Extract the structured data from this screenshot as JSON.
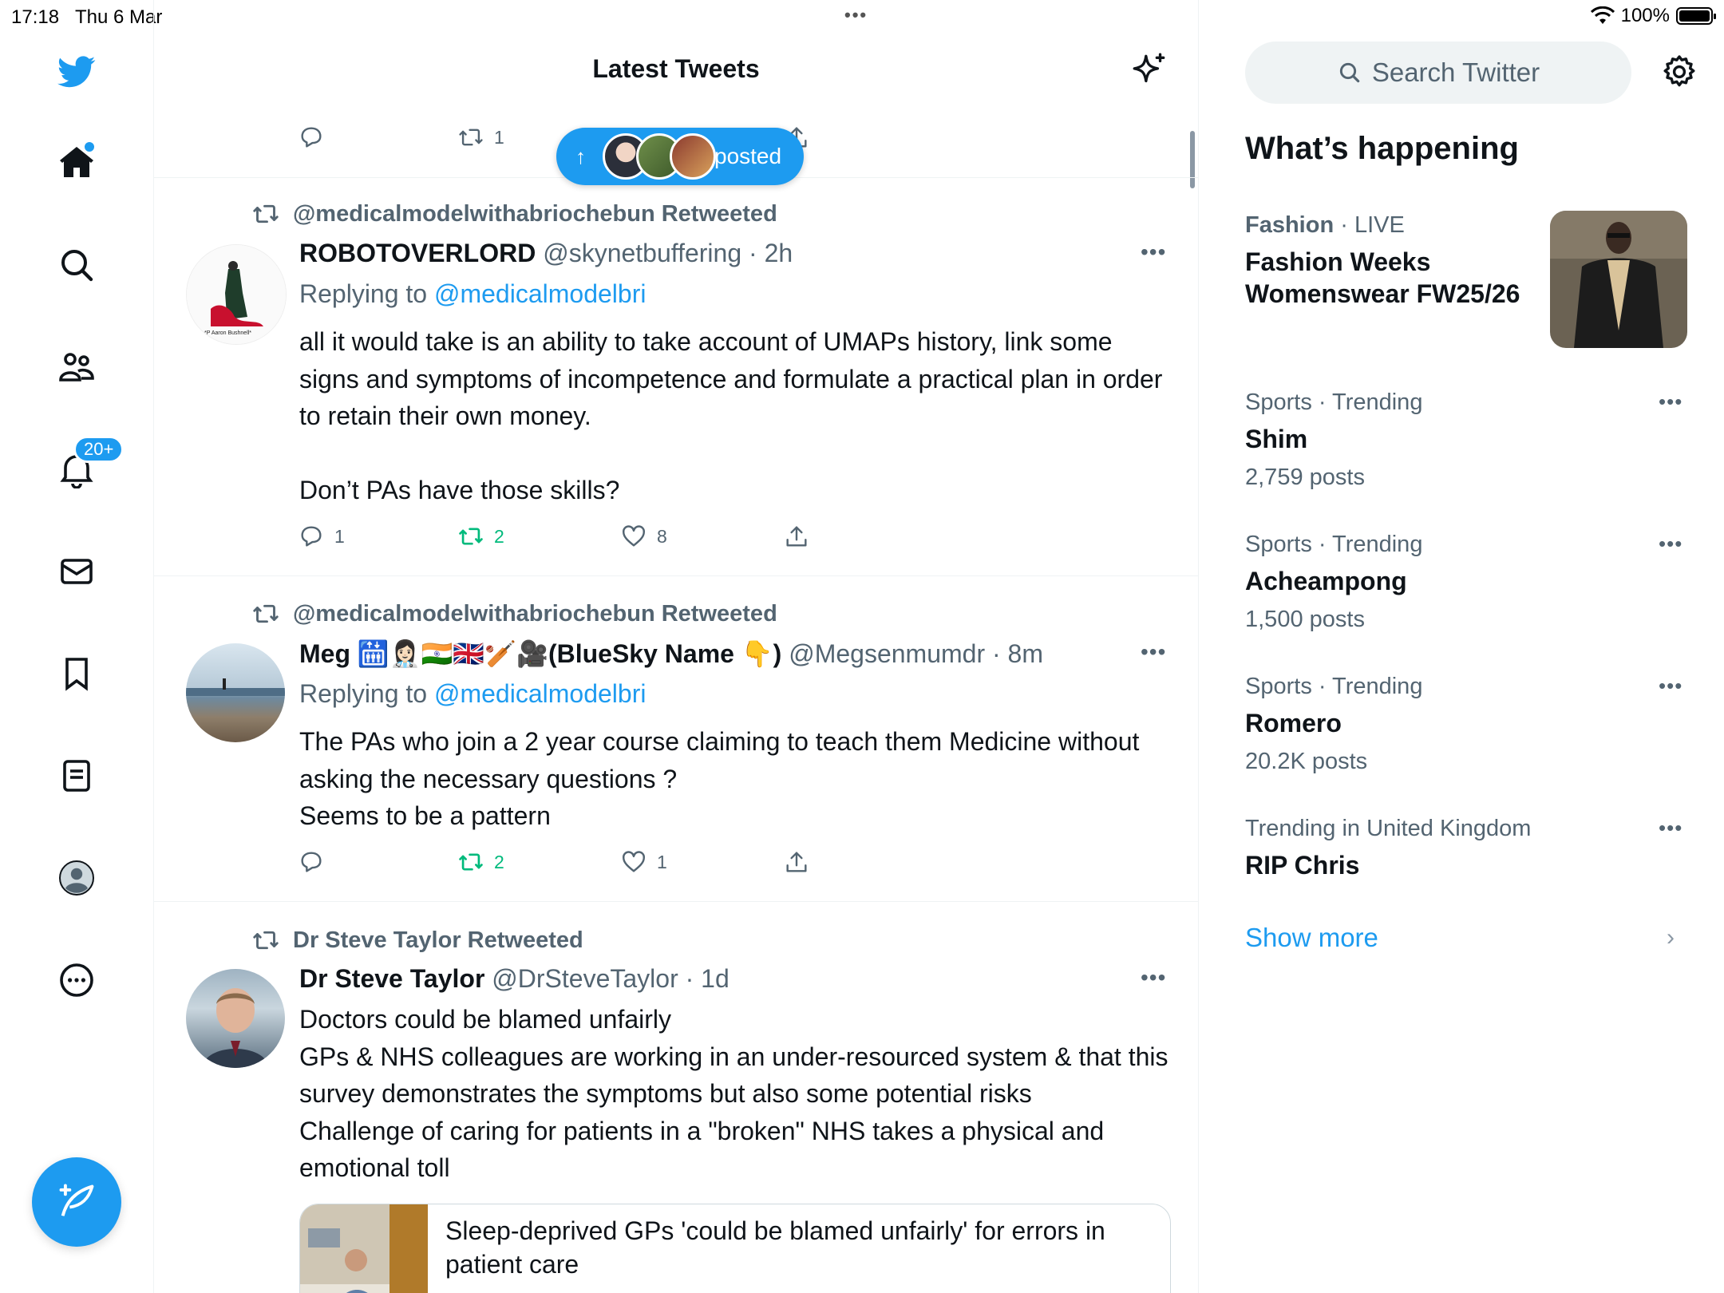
{
  "status_bar": {
    "time": "17:18",
    "date": "Thu 6 Mar",
    "battery": "100%"
  },
  "nav": {
    "notifications_badge": "20+"
  },
  "header": {
    "title": "Latest Tweets"
  },
  "new_posts_pill": {
    "label": "posted"
  },
  "top_partial_tweet": {
    "reply_count": "",
    "retweet_count": "1"
  },
  "tweets": [
    {
      "retweeted_by": "@medicalmodelwithabriochebun Retweeted",
      "name": "ROBOTOVERLORD",
      "handle": "@skynetbuffering",
      "time": "· 2h",
      "replying_prefix": "Replying to ",
      "replying_to": "@medicalmodelbri",
      "text": "all it would take is an ability to take account of UMAPs history, link some signs and symptoms of incompetence and formulate a practical plan in order to retain their own money.\n\nDon’t PAs have those skills?",
      "replies": "1",
      "retweets": "2",
      "likes": "8"
    },
    {
      "retweeted_by": "@medicalmodelwithabriochebun Retweeted",
      "name": "Meg 🛗👩🏻‍⚕️🇮🇳🇬🇧🏏🎥(BlueSky Name 👇)",
      "handle": "@Megsenmumdr",
      "time": "· 8m",
      "replying_prefix": "Replying to ",
      "replying_to": "@medicalmodelbri",
      "text": "The PAs who join a 2 year course claiming to teach them Medicine without asking the necessary questions ?\nSeems to be a pattern",
      "replies": "",
      "retweets": "2",
      "likes": "1"
    },
    {
      "retweeted_by": "Dr Steve Taylor Retweeted",
      "name": "Dr Steve Taylor",
      "handle": "@DrSteveTaylor",
      "time": "· 1d",
      "text": "Doctors could be blamed unfairly\nGPs & NHS colleagues are working in an under-resourced system & that this survey demonstrates the symptoms but also some potential risks\nChallenge of caring for patients in a \"broken\" NHS takes a physical and emotional toll",
      "card_title": "Sleep-deprived GPs 'could be blamed unfairly' for errors in patient care"
    }
  ],
  "search": {
    "placeholder": "Search Twitter"
  },
  "whats_happening": {
    "title": "What’s happening",
    "fashion": {
      "category": "Fashion",
      "live": " · LIVE",
      "title": "Fashion Weeks Womenswear FW25/26"
    },
    "trends": [
      {
        "category": "Sports · Trending",
        "title": "Shim",
        "count": "2,759 posts"
      },
      {
        "category": "Sports · Trending",
        "title": "Acheampong",
        "count": "1,500 posts"
      },
      {
        "category": "Sports · Trending",
        "title": "Romero",
        "count": "20.2K posts"
      },
      {
        "category": "Trending in United Kingdom",
        "title": "RIP Chris",
        "count": ""
      }
    ],
    "show_more": "Show more"
  },
  "colors": {
    "accent": "#1d9bf0",
    "retweet_green": "#00ba7c",
    "secondary_text": "#536471"
  },
  "icons": [
    "twitter-bird-icon",
    "home-icon",
    "search-icon",
    "communities-icon",
    "bell-icon",
    "mail-icon",
    "bookmark-icon",
    "lists-icon",
    "profile-icon",
    "more-circle-icon",
    "compose-icon",
    "sparkle-icon",
    "gear-icon"
  ]
}
